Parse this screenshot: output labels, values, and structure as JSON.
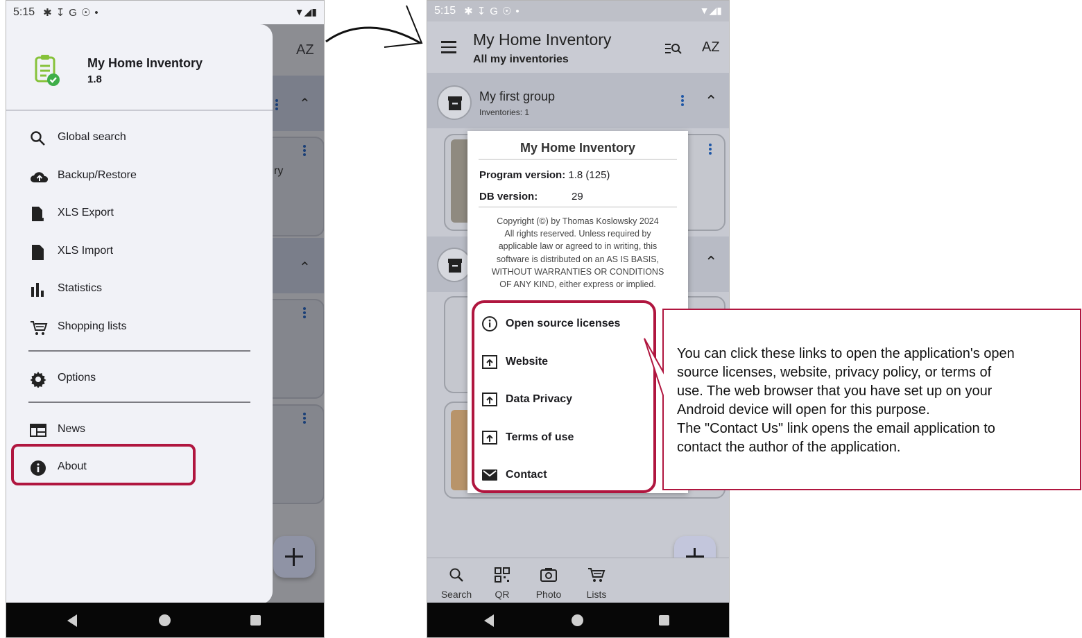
{
  "colors": {
    "highlight": "#b0163f",
    "accent": "#1f57a6",
    "logo_green": "#86c23a"
  },
  "left_phone": {
    "status": {
      "time": "5:15",
      "icons": [
        "settings-icon",
        "download-icon",
        "google-icon",
        "vpn-icon",
        "dot-icon"
      ],
      "right_icons": [
        "wifi-icon",
        "signal-icon",
        "battery-icon"
      ]
    },
    "background": {
      "sort_label": "AZ",
      "partial_text": "ry"
    },
    "drawer": {
      "app_name": "My Home Inventory",
      "version": "1.8",
      "items": [
        {
          "label": "Global search",
          "icon": "search-icon"
        },
        {
          "label": "Backup/Restore",
          "icon": "cloud-upload-icon"
        },
        {
          "label": "XLS Export",
          "icon": "file-export-icon"
        },
        {
          "label": "XLS Import",
          "icon": "file-icon"
        },
        {
          "label": "Statistics",
          "icon": "bar-chart-icon"
        },
        {
          "label": "Shopping lists",
          "icon": "cart-icon"
        },
        {
          "label": "Options",
          "icon": "gear-icon"
        },
        {
          "label": "News",
          "icon": "news-icon"
        },
        {
          "label": "About",
          "icon": "info-icon"
        }
      ]
    }
  },
  "right_phone": {
    "status": {
      "time": "5:15"
    },
    "toolbar": {
      "title": "My Home Inventory",
      "subtitle": "All my inventories",
      "sort_label": "AZ"
    },
    "group": {
      "name": "My first group",
      "count": "Inventories: 1"
    },
    "about_dialog": {
      "title": "My Home Inventory",
      "program_version_label": "Program version:",
      "program_version_value": "1.8 (125)",
      "db_version_label": "DB version:",
      "db_version_value": "29",
      "copyright": [
        "Copyright (©) by Thomas Koslowsky 2024",
        "All rights reserved. Unless required by",
        "applicable law or agreed to in writing, this",
        "software is distributed on an AS IS BASIS,",
        "WITHOUT WARRANTIES OR CONDITIONS",
        "OF ANY KIND, either express or implied."
      ],
      "links": [
        {
          "label": "Open source licenses",
          "icon": "info-outline-icon"
        },
        {
          "label": "Website",
          "icon": "open-external-icon"
        },
        {
          "label": "Data Privacy",
          "icon": "open-external-icon"
        },
        {
          "label": "Terms of use",
          "icon": "open-external-icon"
        },
        {
          "label": "Contact",
          "icon": "mail-icon"
        }
      ]
    },
    "bottom_nav": [
      {
        "label": "Search",
        "icon": "search-icon"
      },
      {
        "label": "QR",
        "icon": "qr-code-icon"
      },
      {
        "label": "Photo",
        "icon": "camera-icon"
      },
      {
        "label": "Lists",
        "icon": "cart-icon"
      }
    ]
  },
  "callout": {
    "lines": [
      "You can click these links to open the application's open",
      "source licenses, website, privacy policy, or terms of",
      "use. The web browser that you have set up on your",
      "Android device will open for this purpose.",
      "The \"Contact Us\" link opens the email application to",
      "contact the author of the application."
    ]
  }
}
